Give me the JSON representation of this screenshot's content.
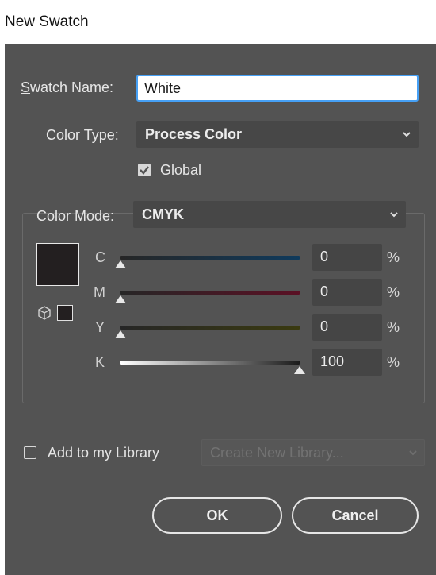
{
  "window": {
    "title": "New Swatch"
  },
  "form": {
    "swatch_name_label": "Swatch Name:",
    "swatch_name_value": "White",
    "color_type_label": "Color Type:",
    "color_type_value": "Process Color",
    "global_label": "Global",
    "global_checked": true,
    "color_mode_label": "Color Mode:",
    "color_mode_value": "CMYK"
  },
  "channels": [
    {
      "letter": "C",
      "value": "0",
      "unit": "%"
    },
    {
      "letter": "M",
      "value": "0",
      "unit": "%"
    },
    {
      "letter": "Y",
      "value": "0",
      "unit": "%"
    },
    {
      "letter": "K",
      "value": "100",
      "unit": "%"
    }
  ],
  "library": {
    "add_label": "Add to my Library",
    "add_checked": false,
    "select_placeholder": "Create New Library..."
  },
  "buttons": {
    "ok": "OK",
    "cancel": "Cancel"
  },
  "colors": {
    "dialog_bg": "#535353",
    "swatch_color": "#231f20",
    "focus_border": "#46a0f5",
    "track_cyan": "#0f3a5c",
    "track_magenta": "#5a1024",
    "track_yellow": "#3a3a10",
    "track_black_start": "#ffffff",
    "track_black_end": "#1a1a1a"
  },
  "icons": {
    "out_of_gamut": "cube-icon",
    "dropdown": "chevron-down-icon"
  }
}
